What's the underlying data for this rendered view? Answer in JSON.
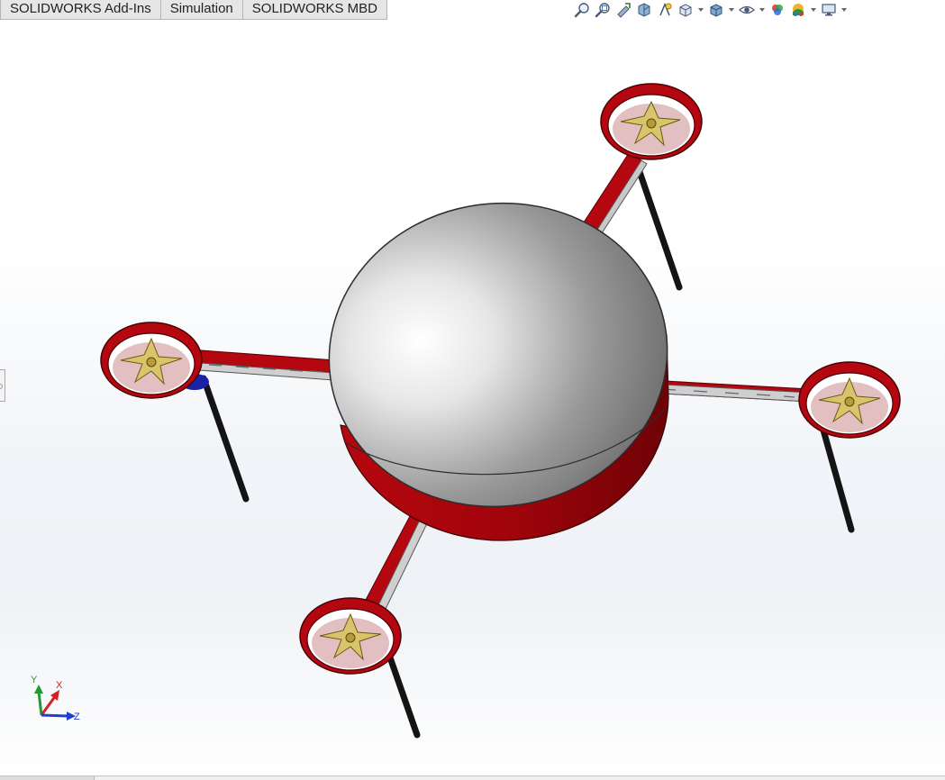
{
  "tabs": [
    {
      "label": "SOLIDWORKS Add-Ins"
    },
    {
      "label": "Simulation"
    },
    {
      "label": "SOLIDWORKS MBD"
    }
  ],
  "heads_up_toolbar": {
    "icons": [
      "zoom-to-fit-icon",
      "zoom-to-area-icon",
      "previous-view-icon",
      "section-view-icon",
      "dynamic-annotation-icon",
      "view-orientation-icon",
      "display-style-icon",
      "hide-show-items-icon",
      "edit-appearance-icon",
      "apply-scene-icon",
      "view-settings-icon"
    ]
  },
  "triad": {
    "x_label": "X",
    "y_label": "Y",
    "z_label": "Z"
  },
  "colors": {
    "frame_red": "#b5070f",
    "body_silver": "#c9c9c9",
    "propeller_gold": "#d8c46a",
    "motor_blue": "#1a22a8",
    "landing_leg": "#141414",
    "axis_x": "#d62020",
    "axis_y": "#1e9a32",
    "axis_z": "#1f3fd0"
  }
}
